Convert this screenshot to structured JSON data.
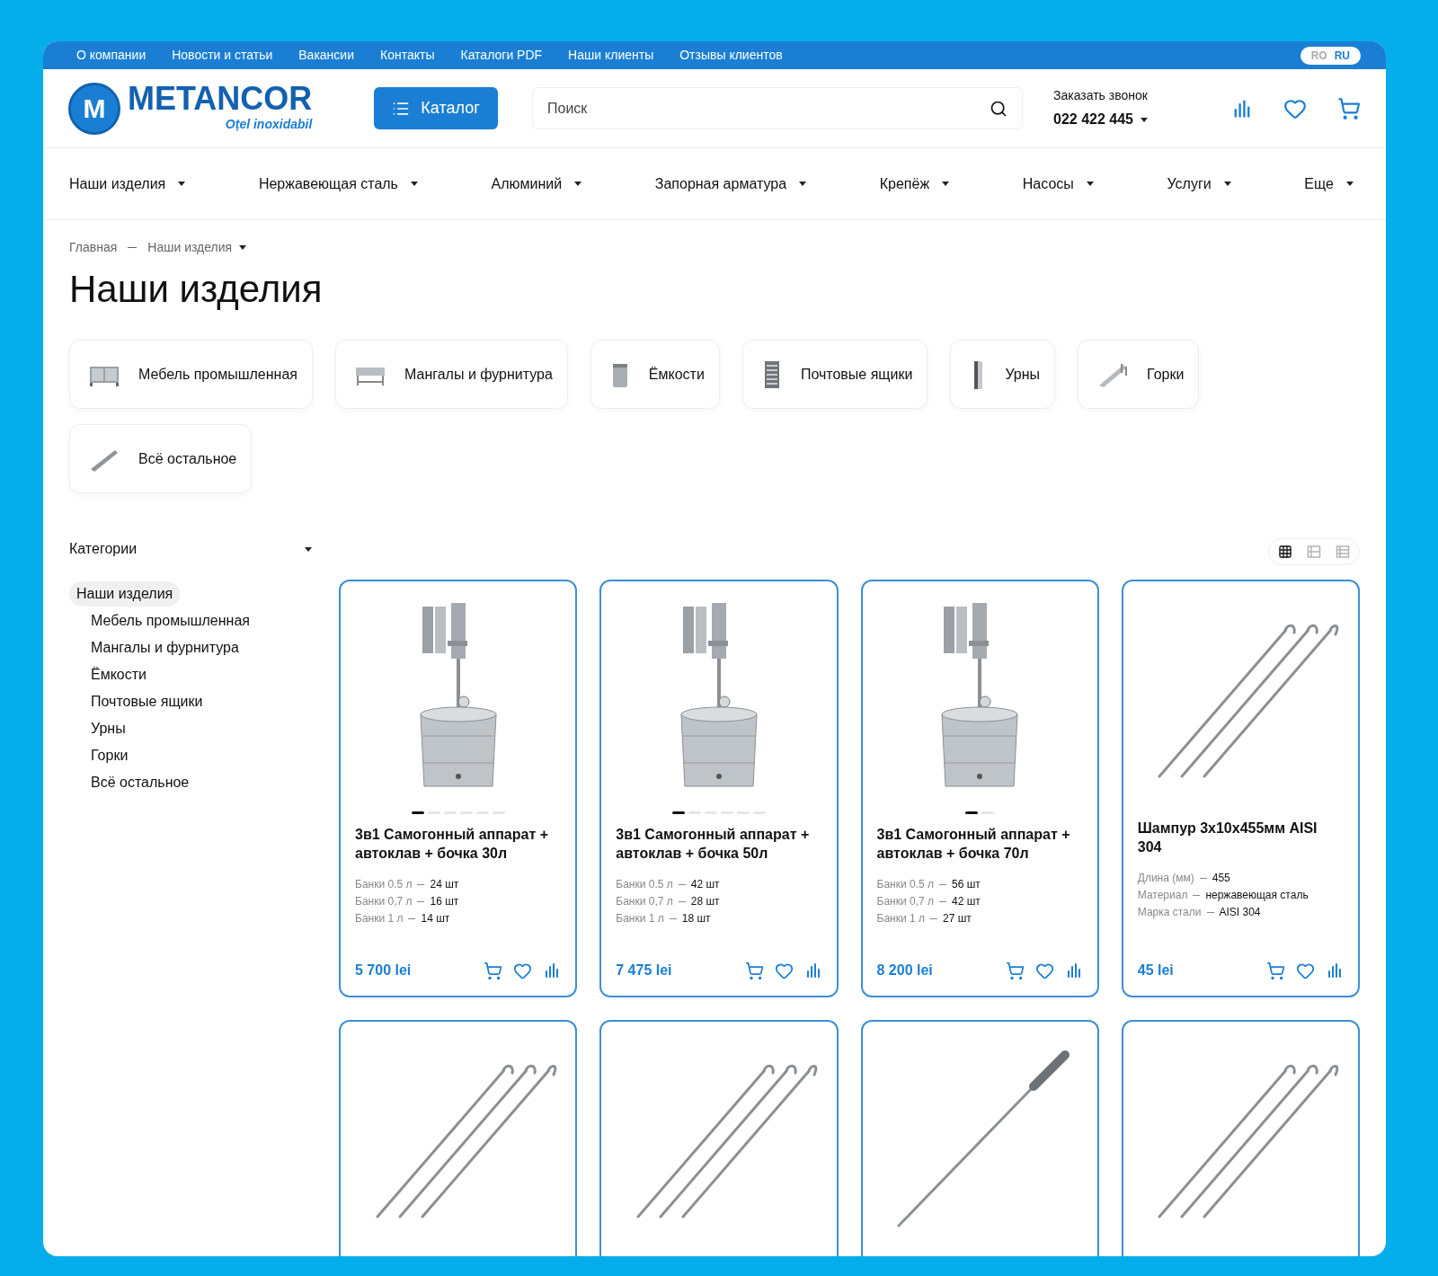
{
  "top_links": [
    "О компании",
    "Новости и статьи",
    "Вакансии",
    "Контакты",
    "Каталоги PDF",
    "Наши клиенты",
    "Отзывы клиентов"
  ],
  "languages": [
    {
      "label": "RO",
      "selected": false
    },
    {
      "label": "RU",
      "selected": true
    }
  ],
  "logo": {
    "emblem": "M",
    "name": "METANCOR",
    "tagline": "Oțel inoxidabil"
  },
  "catalog_button": "Каталог",
  "search": {
    "placeholder": "Поиск"
  },
  "callback": {
    "label": "Заказать звонок",
    "phone": "022 422 445"
  },
  "nav": [
    "Наши изделия",
    "Нержавеющая сталь",
    "Алюминий",
    "Запорная арматура",
    "Крепёж",
    "Насосы",
    "Услуги",
    "Еще"
  ],
  "breadcrumb": [
    "Главная",
    "Наши изделия"
  ],
  "title": "Наши изделия",
  "category_chips": [
    {
      "label": "Мебель промышленная",
      "kind": "furniture"
    },
    {
      "label": "Мангалы и фурнитура",
      "kind": "grill"
    },
    {
      "label": "Ёмкости",
      "kind": "container"
    },
    {
      "label": "Почтовые ящики",
      "kind": "mailbox"
    },
    {
      "label": "Урны",
      "kind": "urn"
    },
    {
      "label": "Горки",
      "kind": "slide"
    },
    {
      "label": "Всё остальное",
      "kind": "rod"
    }
  ],
  "sidebar": {
    "title": "Категории",
    "tree": [
      {
        "label": "Наши изделия",
        "selected": true,
        "children": [
          {
            "label": "Мебель промышленная",
            "selected": false
          },
          {
            "label": "Мангалы и фурнитура",
            "selected": false
          },
          {
            "label": "Ёмкости",
            "selected": false
          },
          {
            "label": "Почтовые ящики",
            "selected": false
          },
          {
            "label": "Урны",
            "selected": false
          },
          {
            "label": "Горки",
            "selected": false
          },
          {
            "label": "Всё остальное",
            "selected": false
          }
        ]
      }
    ]
  },
  "view_modes": [
    {
      "kind": "grid",
      "selected": true
    },
    {
      "kind": "cards",
      "selected": false
    },
    {
      "kind": "list",
      "selected": false
    }
  ],
  "products": [
    {
      "kind": "still",
      "title": "3в1 Самогонный аппарат + автоклав + бочка 30л",
      "specs": [
        {
          "label": "Банки 0.5 л",
          "value": "24 шт"
        },
        {
          "label": "Банки 0,7 л",
          "value": "16 шт"
        },
        {
          "label": "Банки 1 л",
          "value": "14 шт"
        }
      ],
      "price": "5 700 lei",
      "dots": [
        {
          "selected": true
        },
        {
          "selected": false
        },
        {
          "selected": false
        },
        {
          "selected": false
        },
        {
          "selected": false
        },
        {
          "selected": false
        }
      ]
    },
    {
      "kind": "still",
      "title": "3в1 Самогонный аппарат + автоклав + бочка 50л",
      "specs": [
        {
          "label": "Банки 0.5 л",
          "value": "42 шт"
        },
        {
          "label": "Банки 0,7 л",
          "value": "28 шт"
        },
        {
          "label": "Банки 1 л",
          "value": "18 шт"
        }
      ],
      "price": "7 475 lei",
      "dots": [
        {
          "selected": true
        },
        {
          "selected": false
        },
        {
          "selected": false
        },
        {
          "selected": false
        },
        {
          "selected": false
        },
        {
          "selected": false
        }
      ]
    },
    {
      "kind": "still",
      "title": "3в1 Самогонный аппарат + автоклав + бочка 70л",
      "specs": [
        {
          "label": "Банки 0.5 л",
          "value": "56 шт"
        },
        {
          "label": "Банки 0,7 л",
          "value": "42 шт"
        },
        {
          "label": "Банки 1 л",
          "value": "27 шт"
        }
      ],
      "price": "8 200 lei",
      "dots": [
        {
          "selected": true
        },
        {
          "selected": false
        }
      ]
    },
    {
      "kind": "skewers",
      "title": "Шампур 3х10х455мм AISI 304",
      "specs": [
        {
          "label": "Длина (мм)",
          "value": "455"
        },
        {
          "label": "Материал",
          "value": "нержавеющая сталь"
        },
        {
          "label": "Марка стали",
          "value": "AISI 304"
        }
      ],
      "price": "45 lei"
    },
    {
      "kind": "skewers"
    },
    {
      "kind": "skewers"
    },
    {
      "kind": "skewer"
    },
    {
      "kind": "skewers"
    }
  ]
}
